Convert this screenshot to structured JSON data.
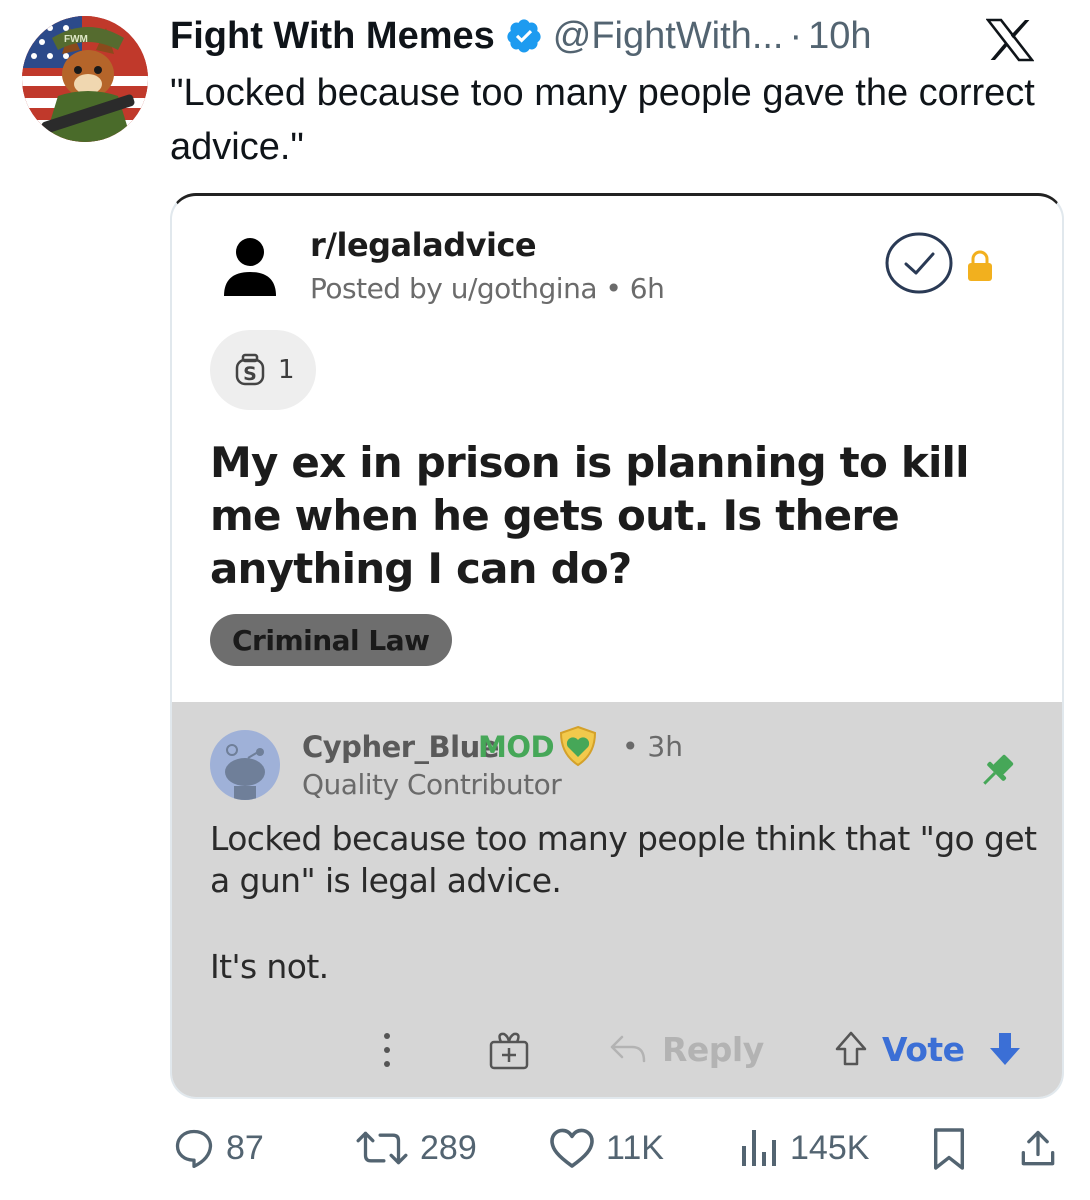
{
  "tweet": {
    "display_name": "Fight With Memes",
    "handle": "@FightWith...",
    "separator": "·",
    "time": "10h",
    "avatar_badge": "FWM",
    "text": "\"Locked because too many people gave the correct advice.\""
  },
  "reddit_post": {
    "subreddit": "r/legaladvice",
    "posted_by": "Posted by u/gothgina • 6h",
    "award_count": "1",
    "title": "My ex in prison is planning to kill me when he gets out. Is there anything I can do?",
    "flair": "Criminal Law"
  },
  "comment": {
    "username": "Cypher_Blue",
    "mod_tag": "MOD",
    "time": "• 3h",
    "user_flair": "Quality Contributor",
    "body_1": "Locked because too many people think that \"go get a gun\" is legal advice.",
    "body_2": "It's not.",
    "reply_label": "Reply",
    "vote_label": "Vote"
  },
  "metrics": {
    "replies": "87",
    "retweets": "289",
    "likes": "11K",
    "views": "145K"
  },
  "colors": {
    "verified": "#1d9bf0",
    "mod_green": "#46a758",
    "vote_blue": "#3b6fd6",
    "lock_gold": "#f2b01e",
    "comment_bg": "#d6d6d6"
  }
}
